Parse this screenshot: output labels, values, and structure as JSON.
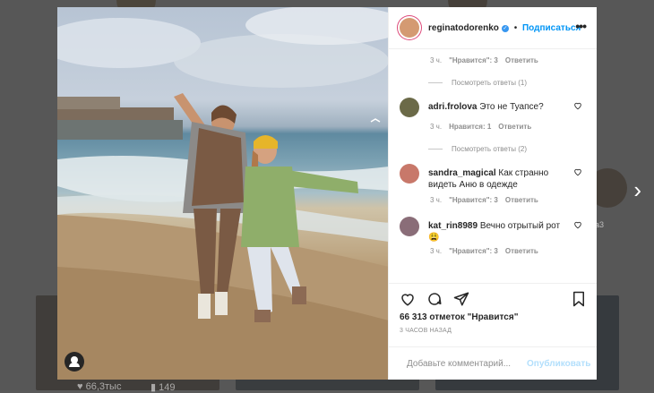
{
  "post": {
    "author": "reginatodorenko",
    "follow_label": "Подписаться",
    "separator": "•",
    "more_label": "•••",
    "likes_text": "66 313 отметок \"Нравится\"",
    "time_ago": "3 ЧАСОВ НАЗАД",
    "add_comment_placeholder": "Добавьте комментарий...",
    "publish_label": "Опубликовать"
  },
  "comments": [
    {
      "type": "meta",
      "age": "3 ч.",
      "likes": "\"Нравится\": 3",
      "reply": "Ответить"
    },
    {
      "type": "replies",
      "label": "Посмотреть ответы (1)"
    },
    {
      "type": "comment",
      "user": "adri.frolova",
      "text": "Это не Туапсе?",
      "age": "3 ч.",
      "likes": "Нравится: 1",
      "reply": "Ответить",
      "avatar_color": "#6b6a48"
    },
    {
      "type": "replies",
      "label": "Посмотреть ответы (2)"
    },
    {
      "type": "comment",
      "user": "sandra_magical",
      "text": "Как странно видеть Аню в одежде",
      "age": "3 ч.",
      "likes": "\"Нравится\": 3",
      "reply": "Ответить",
      "avatar_color": "#c8786a"
    },
    {
      "type": "comment",
      "user": "kat_rin8989",
      "text": "Вечно отрытый рот",
      "emoji": "😩",
      "age": "3 ч.",
      "likes": "\"Нравится\": 3",
      "reply": "Ответить",
      "avatar_color": "#8a6d78"
    }
  ],
  "background": {
    "stats_likes": "66,3тыс",
    "stats_comments": "149",
    "side_label": "а3"
  },
  "icons": [
    "heart-icon",
    "comment-icon",
    "share-icon",
    "bookmark-icon",
    "add-replies-icon",
    "emoji-icon",
    "user-tag-icon",
    "next-arrow-icon",
    "more-icon"
  ],
  "colors": {
    "accent": "#0095f6",
    "publish_disabled": "#b2dffc",
    "text": "#262626",
    "muted": "#8e8e8e"
  }
}
